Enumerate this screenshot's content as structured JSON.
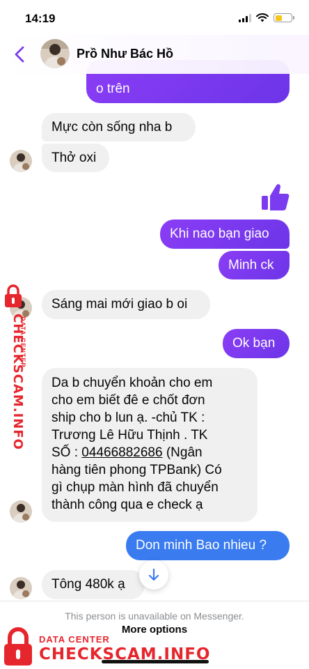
{
  "status_bar": {
    "time": "14:19"
  },
  "header": {
    "contact_name": "Prồ Như Bác Hồ",
    "avatar_icon": "profile-photo"
  },
  "messages": [
    {
      "side": "out",
      "text": "o trên"
    },
    {
      "side": "in",
      "text": "Mực còn sống nha b"
    },
    {
      "side": "in",
      "text": "Thở oxi"
    },
    {
      "side": "out",
      "text": "Khi nao bạn giao"
    },
    {
      "side": "out",
      "text": "Minh ck"
    },
    {
      "side": "in",
      "text": "Sáng mai mới giao b oi"
    },
    {
      "side": "out",
      "text": "Ok bạn"
    },
    {
      "side": "in",
      "text_before": "Da b chuyển khoản cho em\ncho em biết   đê e chốt đơn\nship cho b lun ạ.     -chủ TK :\nTrương Lê Hữu Thịnh    . TK\nSỐ : ",
      "account": "04466882686",
      "text_after": "   (Ngân\nhàng tiên phong TPBank)  Có\ngì chụp màn hình đã chuyển\nthành công qua e check ạ"
    },
    {
      "side": "out",
      "text": "Don minh Bao nhieu ?"
    },
    {
      "side": "in",
      "text": "Tông 480k ạ"
    }
  ],
  "like_icon": "thumbs-up",
  "footer": {
    "unavailable_text": "This person is unavailable on Messenger.",
    "more_options_label": "More options"
  },
  "watermark": {
    "small": "DATA CENTER",
    "big": "CHECKSCAM.INFO"
  },
  "colors": {
    "outgoing": "#7b3cf0",
    "outgoing_last": "#3a7bf0",
    "incoming": "#f0f0f0",
    "accent": "#7b3cf0",
    "watermark": "#e6262d"
  }
}
